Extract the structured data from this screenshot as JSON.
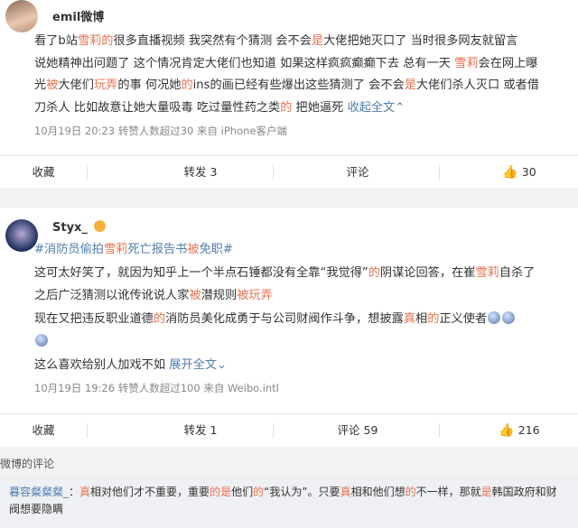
{
  "post1": {
    "username": "emil微博",
    "lines": [
      [
        {
          "t": "看了b站"
        },
        {
          "t": "雪莉的",
          "c": "link"
        },
        {
          "t": "很多直播视频 我突然有个猜测 会不会"
        },
        {
          "t": "是",
          "c": "link"
        },
        {
          "t": "大佬把她灭口了 当时很多网友就留言"
        }
      ],
      [
        {
          "t": "说她精神出问题了 这个情况肯定大佬们也知道 如果这样疯疯癫癫下去 总有一天 "
        },
        {
          "t": "雪莉",
          "c": "link"
        },
        {
          "t": "会在网上曝"
        }
      ],
      [
        {
          "t": "光"
        },
        {
          "t": "被",
          "c": "link"
        },
        {
          "t": "大佬们"
        },
        {
          "t": "玩弄",
          "c": "link"
        },
        {
          "t": "的事 何况她"
        },
        {
          "t": "的",
          "c": "link"
        },
        {
          "t": "ins的画已经有些爆出这些猜测了 会不会"
        },
        {
          "t": "是",
          "c": "link"
        },
        {
          "t": "大佬们杀人灭口 或者借"
        }
      ],
      [
        {
          "t": "刀杀人 比如故意让她大量吸毒 吃过量性药之类"
        },
        {
          "t": "的",
          "c": "link"
        },
        {
          "t": " 把她逼死 "
        },
        {
          "t": "收起全文",
          "c": "blue"
        },
        {
          "t": "⌃",
          "c": "blue"
        }
      ]
    ],
    "meta": "10月19日 20:23 转赞人数超过30  来自 iPhone客户端",
    "actions": {
      "fav": "收藏",
      "repost": "转发 3",
      "comment": "评论",
      "like": "30"
    }
  },
  "post2": {
    "username": "Styx_",
    "lines": [
      [
        {
          "t": "#消防员偷拍",
          "c": "tag"
        },
        {
          "t": "雪莉",
          "c": "link"
        },
        {
          "t": "死亡报告书",
          "c": "tag"
        },
        {
          "t": "被",
          "c": "link"
        },
        {
          "t": "免职#",
          "c": "tag"
        }
      ],
      [
        {
          "t": "这可太好笑了，就因为知乎上一个半点石锤都没有全靠“我觉得”"
        },
        {
          "t": "的",
          "c": "link"
        },
        {
          "t": "阴谋论回答，在崔"
        },
        {
          "t": "雪莉",
          "c": "link"
        },
        {
          "t": "自杀了"
        }
      ],
      [
        {
          "t": "之后广泛猜测以讹传讹说人家"
        },
        {
          "t": "被",
          "c": "link"
        },
        {
          "t": "潜规则"
        },
        {
          "t": "被玩弄",
          "c": "link"
        }
      ],
      [
        {
          "t": "现在又把违反职业道德"
        },
        {
          "t": "的",
          "c": "link"
        },
        {
          "t": "消防员美化成勇于与公司财阀作斗争，想披露"
        },
        {
          "t": "真",
          "c": "link"
        },
        {
          "t": "相"
        },
        {
          "t": "的",
          "c": "link"
        },
        {
          "t": "正义使者"
        }
      ],
      [],
      [
        {
          "t": "这么喜欢给别人加戏不如 "
        },
        {
          "t": "展开全文",
          "c": "blue"
        },
        {
          "t": "⌄",
          "c": "blue"
        }
      ]
    ],
    "meta": "10月19日 19:26 转赞人数超过100  来自 Weibo.intl",
    "actions": {
      "fav": "收藏",
      "repost": "转发 1",
      "comment": "评论 59",
      "like": "216"
    }
  },
  "comments": {
    "title": "微博的评论",
    "line1": [
      {
        "t": "暮容粲粲粲_",
        "c": "blue"
      },
      {
        "t": "："
      },
      {
        "t": "真",
        "c": "link"
      },
      {
        "t": "相对他们才不重要，重要"
      },
      {
        "t": "的",
        "c": "link"
      },
      {
        "t": "是",
        "c": "link"
      },
      {
        "t": "他们"
      },
      {
        "t": "的",
        "c": "link"
      },
      {
        "t": "“我认为”。只要"
      },
      {
        "t": "真",
        "c": "link"
      },
      {
        "t": "相和他们想"
      },
      {
        "t": "的",
        "c": "link"
      },
      {
        "t": "不一样，那就"
      },
      {
        "t": "是",
        "c": "link"
      },
      {
        "t": "韩国政府和财"
      }
    ],
    "line2": [
      {
        "t": "阀想要隐瞒"
      }
    ]
  }
}
